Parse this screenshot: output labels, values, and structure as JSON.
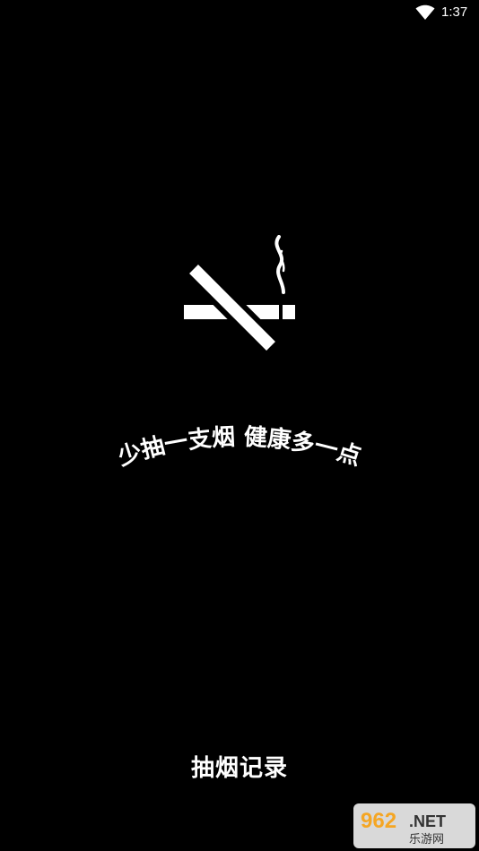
{
  "status_bar": {
    "time": "1:37",
    "wifi_icon": "wifi-icon"
  },
  "splash": {
    "logo_icon": "no-smoking-icon",
    "slogan": "少抽一支烟  健康多一点",
    "app_name": "抽烟记录"
  },
  "watermark": {
    "brand_number": "962",
    "brand_suffix": ".NET",
    "brand_caption": "乐游网"
  },
  "colors": {
    "background": "#000000",
    "foreground": "#ffffff",
    "watermark_orange": "#f5a623"
  }
}
